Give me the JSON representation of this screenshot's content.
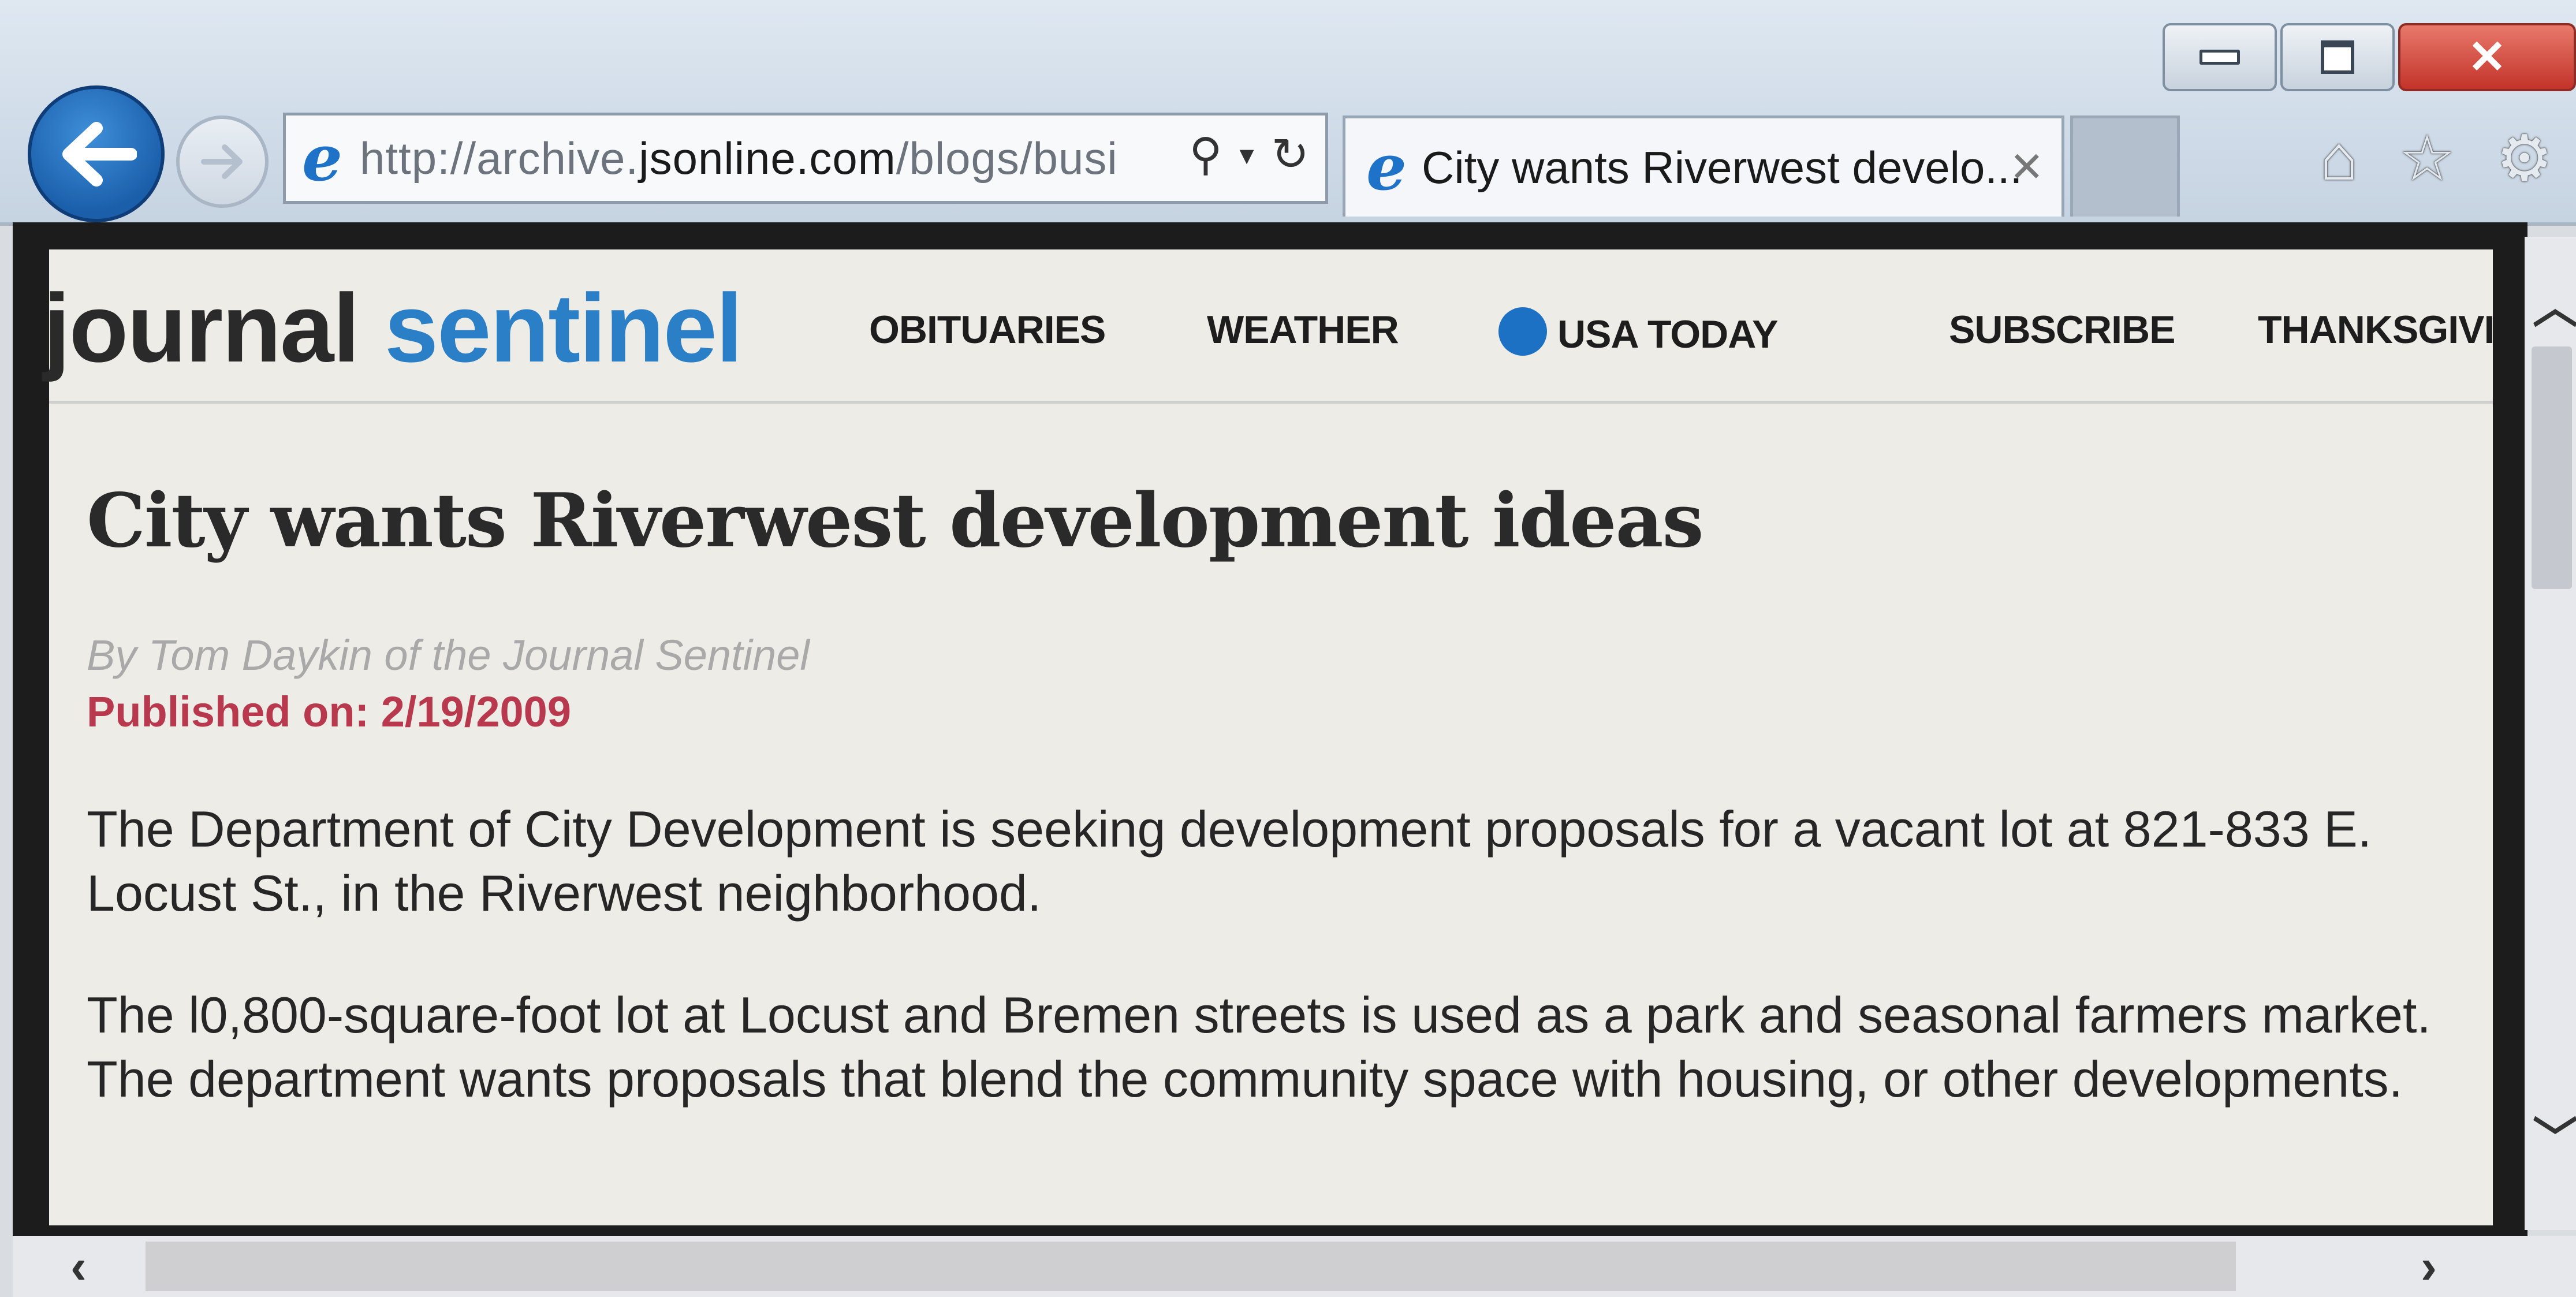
{
  "browser": {
    "address_url_prefix": "http://archive.",
    "address_url_domain": "jsonline.com",
    "address_url_suffix": "/blogs/busi",
    "tab_title": "City wants Riverwest develo..."
  },
  "site": {
    "logo_part1": "journal",
    "logo_part2": "sentinel",
    "nav": [
      "OBITUARIES",
      "WEATHER",
      "USA TODAY",
      "SUBSCRIBE",
      "THANKSGIVIN"
    ]
  },
  "article": {
    "headline": "City wants Riverwest development ideas",
    "byline": "By Tom Daykin of the Journal Sentinel",
    "published": "Published on: 2/19/2009",
    "paragraphs": [
      "The Department of City Development is seeking development proposals for a vacant lot at 821-833 E. Locust St., in the Riverwest neighborhood.",
      "The l0,800-square-foot lot at Locust and Bremen streets is used as a park and seasonal farmers market. The department wants proposals that blend the community space with housing, or other developments."
    ]
  },
  "colors": {
    "logo_blue": "#2b7fc7",
    "published_red": "#b8394d",
    "close_red": "#c3332a"
  },
  "icons": [
    "back-icon",
    "forward-icon",
    "ie-icon",
    "search-icon",
    "dropdown-icon",
    "refresh-icon",
    "close-tab-icon",
    "home-icon",
    "star-icon",
    "gear-icon"
  ]
}
